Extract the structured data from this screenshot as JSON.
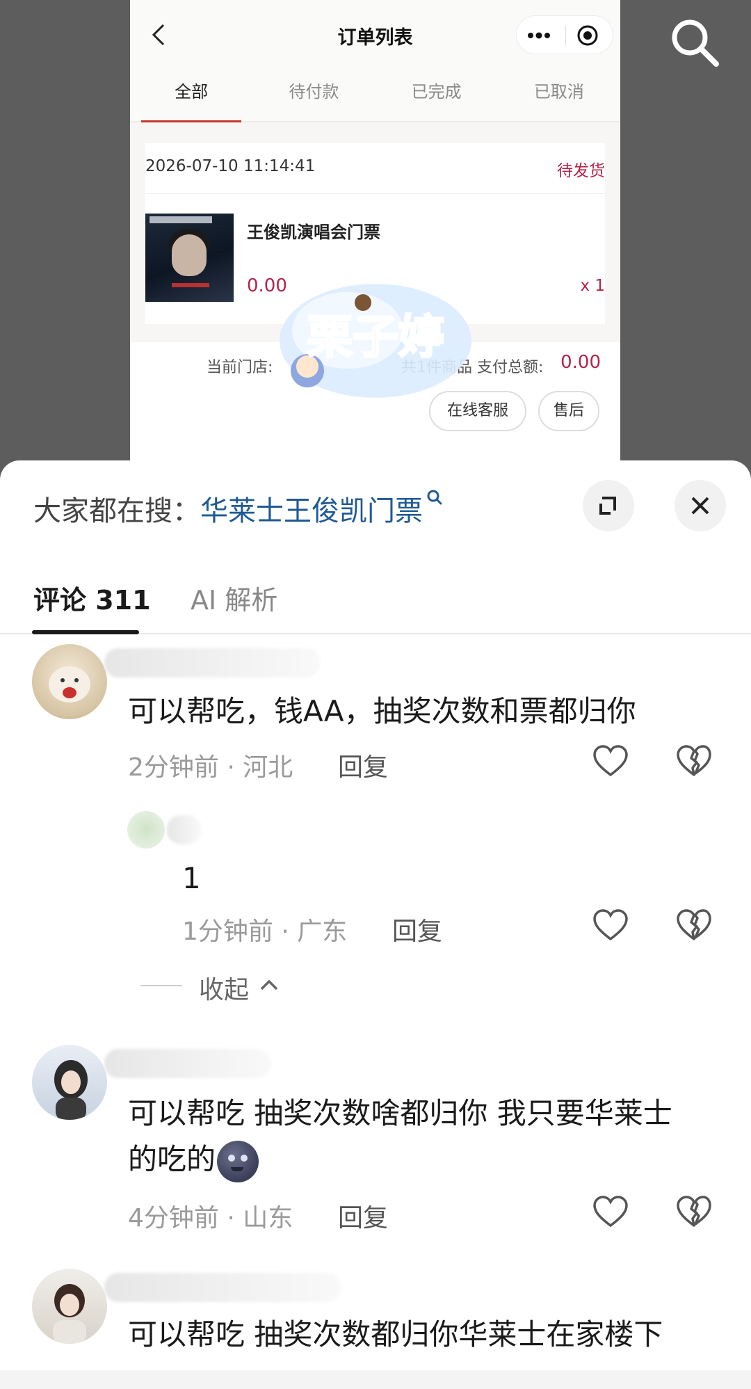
{
  "order_page": {
    "title": "订单列表",
    "tabs": [
      "全部",
      "待付款",
      "已完成",
      "已取消"
    ],
    "order": {
      "datetime": "2026-07-10 11:14:41",
      "status": "待发货",
      "product_name": "王俊凯演唱会门票",
      "price": "0.00",
      "quantity": "x 1",
      "store_label": "当前门店:",
      "summary_label": "共1件商品 支付总额:",
      "total": "0.00",
      "button_service": "在线客服",
      "button_after_sale": "售后"
    },
    "watermark_text": "栗子婷"
  },
  "sheet": {
    "search_prefix": "大家都在搜：",
    "search_keyword": "华莱士王俊凯门票",
    "tabs": [
      "评论 311",
      "AI 解析"
    ]
  },
  "comments": [
    {
      "text": "可以帮吃，钱AA，抽奖次数和票都归你",
      "time_location": "2分钟前 · 河北",
      "reply_label": "回复"
    },
    {
      "text": "1",
      "time_location": "1分钟前 · 广东",
      "reply_label": "回复"
    },
    {
      "text_line1": "可以帮吃 抽奖次数啥都归你 我只要华莱士",
      "text_line2": "的吃的",
      "time_location": "4分钟前 · 山东",
      "reply_label": "回复"
    },
    {
      "text": "可以帮吃 抽奖次数都归你华莱士在家楼下"
    }
  ],
  "collapse_label": "收起",
  "icons": {
    "search": "search-icon",
    "back": "chevron-left-icon",
    "more": "more-dots-icon",
    "target": "target-icon",
    "expand": "expand-icon",
    "close": "close-icon",
    "like": "heart-icon",
    "dislike": "broken-heart-icon",
    "collapse": "chevron-up-icon"
  },
  "colors": {
    "accent_red": "#b5244a",
    "tab_indicator": "#c8372a",
    "keyword_blue": "#1f5a94"
  }
}
